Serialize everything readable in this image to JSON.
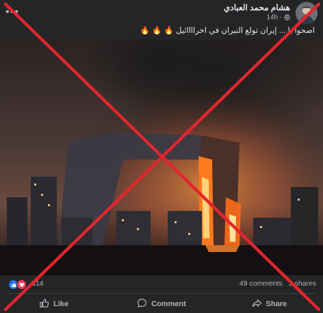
{
  "post": {
    "author_name": "هشام محمد العبادي",
    "timestamp": "14h",
    "caption": "اصحوا يا ... إيران تولع النيران في اخراااائيل 🔥 🔥 🔥"
  },
  "stats": {
    "reaction_count": "314",
    "comments_label": "49 comments",
    "shares_label": "3 shares"
  },
  "actions": {
    "like": "Like",
    "comment": "Comment",
    "share": "Share"
  },
  "icons": {
    "menu": "more-options-icon",
    "privacy": "globe-icon",
    "like": "thumbs-up-icon",
    "comment": "comment-bubble-icon",
    "share": "share-arrow-icon"
  },
  "colors": {
    "background": "#242526",
    "text": "#e4e6eb",
    "secondary_text": "#b0b3b8",
    "like_blue": "#1877f2",
    "love_red": "#f33e58",
    "overlay_red": "#e0262e"
  }
}
